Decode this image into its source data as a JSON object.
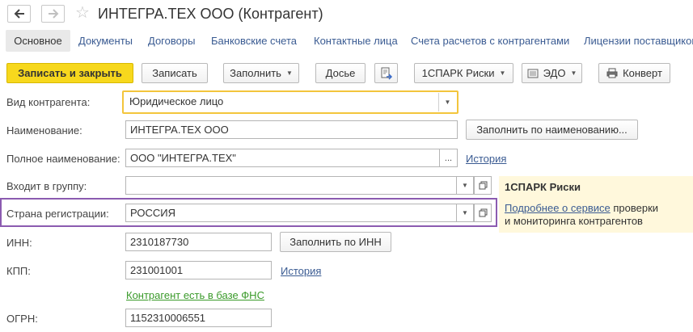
{
  "window": {
    "title": "ИНТЕГРА.ТЕХ ООО (Контрагент)"
  },
  "nav": {
    "back_icon": "arrow-left-icon",
    "forward_icon": "arrow-right-icon",
    "favorite_icon": "star-icon"
  },
  "tabs": [
    {
      "label": "Основное",
      "active": true
    },
    {
      "label": "Документы"
    },
    {
      "label": "Договоры"
    },
    {
      "label": "Банковские счета"
    },
    {
      "label": "Контактные лица"
    },
    {
      "label": "Счета расчетов с контрагентами"
    },
    {
      "label": "Лицензии поставщиков"
    }
  ],
  "toolbar": {
    "save_close": "Записать и закрыть",
    "save": "Записать",
    "fill": "Заполнить",
    "dossier": "Досье",
    "spark": "1СПАРК Риски",
    "edo": "ЭДО",
    "envelope": "Конверт"
  },
  "form": {
    "kind": {
      "label": "Вид контрагента:",
      "value": "Юридическое лицо"
    },
    "name": {
      "label": "Наименование:",
      "value": "ИНТЕГРА.ТЕХ ООО",
      "fill_button": "Заполнить по наименованию..."
    },
    "full_name": {
      "label": "Полное наименование:",
      "value": "ООО \"ИНТЕГРА.ТЕХ\"",
      "choose": "...",
      "history": "История"
    },
    "group": {
      "label": "Входит в группу:",
      "value": ""
    },
    "country": {
      "label": "Страна регистрации:",
      "value": "РОССИЯ"
    },
    "inn": {
      "label": "ИНН:",
      "value": "2310187730",
      "fill_button": "Заполнить по ИНН"
    },
    "kpp": {
      "label": "КПП:",
      "value": "231001001",
      "history": "История"
    },
    "fns_note": "Контрагент есть в базе ФНС",
    "ogrn": {
      "label": "ОГРН:",
      "value": "1152310006551"
    }
  },
  "spark_panel": {
    "title": "1СПАРК Риски",
    "link": "Подробнее о сервисе",
    "text1": "проверки",
    "text2": "и мониторинга контрагентов"
  },
  "colors": {
    "primary_button": "#f7d81d",
    "link": "#3a5b92",
    "fns_link": "#3a9a2a",
    "highlight_yellow": "#f3c53c",
    "highlight_purple": "#8b5bb0",
    "panel_bg": "#fff8dc"
  }
}
